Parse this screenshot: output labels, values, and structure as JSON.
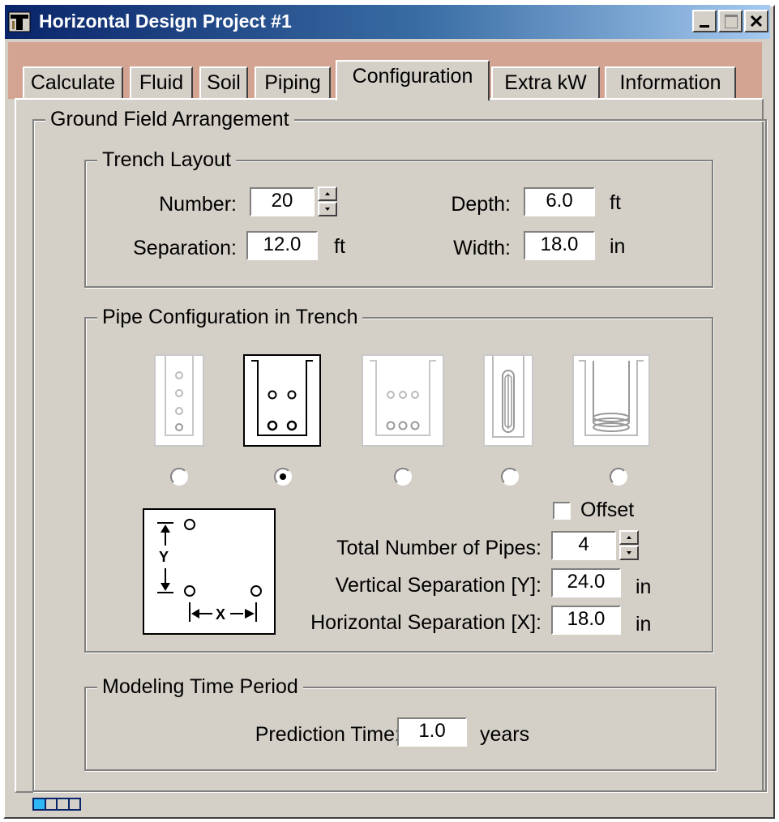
{
  "window": {
    "title": "Horizontal Design Project #1"
  },
  "tabs": [
    "Calculate",
    "Fluid",
    "Soil",
    "Piping",
    "Configuration",
    "Extra kW",
    "Information"
  ],
  "active_tab": "Configuration",
  "ground_field": {
    "legend": "Ground Field Arrangement",
    "trench_layout": {
      "legend": "Trench Layout",
      "number_label": "Number:",
      "number_value": "20",
      "separation_label": "Separation:",
      "separation_value": "12.0",
      "separation_unit": "ft",
      "depth_label": "Depth:",
      "depth_value": "6.0",
      "depth_unit": "ft",
      "width_label": "Width:",
      "width_value": "18.0",
      "width_unit": "in"
    },
    "pipe_config": {
      "legend": "Pipe Configuration in Trench",
      "selected_option": 2,
      "offset_label": "Offset",
      "offset_checked": false,
      "total_pipes_label": "Total Number of Pipes:",
      "total_pipes_value": "4",
      "vertical_sep_label": "Vertical Separation [Y]:",
      "vertical_sep_value": "24.0",
      "vertical_sep_unit": "in",
      "horizontal_sep_label": "Horizontal Separation [X]:",
      "horizontal_sep_value": "18.0",
      "horizontal_sep_unit": "in",
      "diagram_y_label": "Y",
      "diagram_x_label": "X"
    },
    "modeling": {
      "legend": "Modeling Time Period",
      "prediction_label": "Prediction Time:",
      "prediction_value": "1.0",
      "prediction_unit": "years"
    }
  }
}
